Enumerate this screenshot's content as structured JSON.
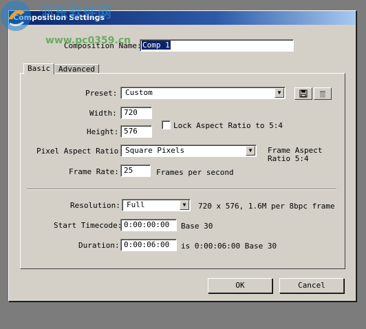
{
  "window": {
    "title": "Composition Settings"
  },
  "watermark": {
    "text": "河东软件网",
    "url": "www.pc0359.cn"
  },
  "composition_name": {
    "label": "Composition Name:",
    "value": "Comp 1"
  },
  "tabs": [
    {
      "label": "Basic"
    },
    {
      "label": "Advanced"
    }
  ],
  "preset": {
    "label": "Preset:",
    "value": "Custom"
  },
  "width": {
    "label": "Width:",
    "value": "720"
  },
  "height": {
    "label": "Height:",
    "value": "576"
  },
  "lock_aspect": {
    "label": "Lock Aspect Ratio to 5:4",
    "checked": false
  },
  "pixel_aspect": {
    "label": "Pixel Aspect Ratio:",
    "value": "Square Pixels",
    "info_line1": "Frame Aspect",
    "info_line2": "Ratio 5:4"
  },
  "frame_rate": {
    "label": "Frame Rate:",
    "value": "25",
    "suffix": "Frames per second"
  },
  "resolution": {
    "label": "Resolution:",
    "value": "Full",
    "info": "720 x 576, 1.6M per 8bpc frame"
  },
  "start_timecode": {
    "label": "Start Timecode:",
    "value": "0:00:00:00",
    "suffix": "Base 30"
  },
  "duration": {
    "label": "Duration:",
    "value": "0:00:06:00",
    "suffix": "is 0:00:06:00  Base 30"
  },
  "buttons": {
    "ok": "OK",
    "cancel": "Cancel"
  },
  "icons": {
    "save": "floppy-disk-icon",
    "delete": "trash-icon",
    "dropdown": "chevron-down-icon"
  }
}
